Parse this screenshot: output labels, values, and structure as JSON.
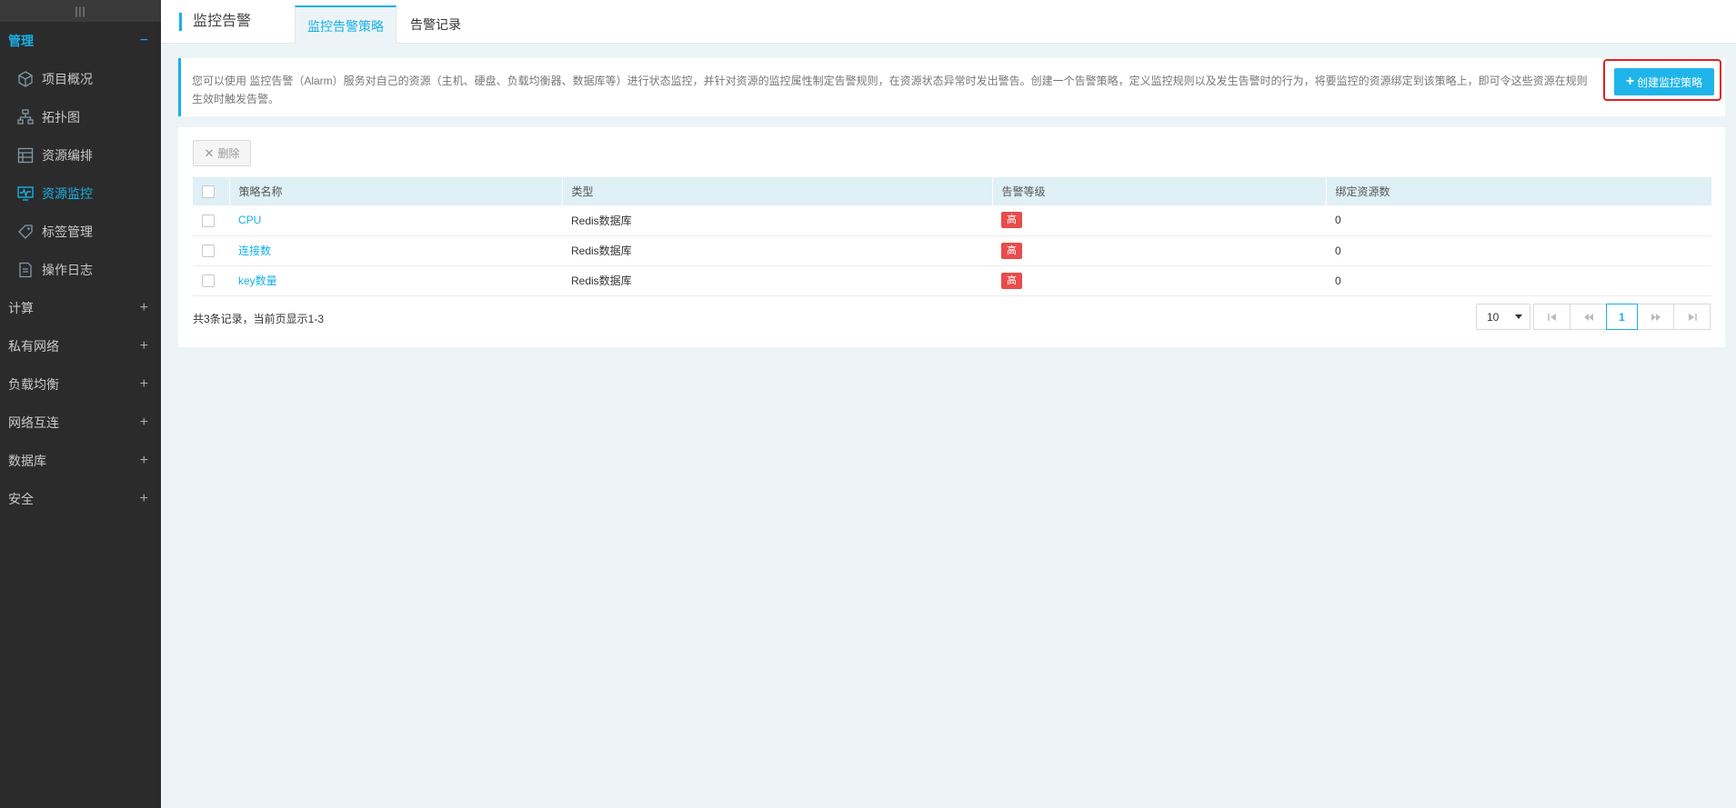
{
  "sidebar": {
    "collapse_glyph": "|||",
    "groups": [
      {
        "label": "管理",
        "sign": "−",
        "active": true
      },
      {
        "label": "计算",
        "sign": "+"
      },
      {
        "label": "私有网络",
        "sign": "+"
      },
      {
        "label": "负载均衡",
        "sign": "+"
      },
      {
        "label": "网络互连",
        "sign": "+"
      },
      {
        "label": "数据库",
        "sign": "+"
      },
      {
        "label": "安全",
        "sign": "+"
      }
    ],
    "items": [
      {
        "label": "项目概况",
        "icon": "cube-icon"
      },
      {
        "label": "拓扑图",
        "icon": "topology-icon"
      },
      {
        "label": "资源编排",
        "icon": "orchestration-icon"
      },
      {
        "label": "资源监控",
        "icon": "monitor-icon",
        "active": true
      },
      {
        "label": "标签管理",
        "icon": "tag-icon"
      },
      {
        "label": "操作日志",
        "icon": "log-icon"
      }
    ]
  },
  "header": {
    "title": "监控告警",
    "tabs": [
      {
        "label": "监控告警策略",
        "active": true
      },
      {
        "label": "告警记录"
      }
    ]
  },
  "info": {
    "text": "您可以使用 监控告警（Alarm）服务对自己的资源（主机、硬盘、负载均衡器、数据库等）进行状态监控，并针对资源的监控属性制定告警规则，在资源状态异常时发出警告。创建一个告警策略，定义监控规则以及发生告警时的行为，将要监控的资源绑定到该策略上，即可令这些资源在规则生效时触发告警。",
    "create_label": "创建监控策略"
  },
  "toolbar": {
    "delete_label": "删除"
  },
  "table": {
    "headers": [
      "策略名称",
      "类型",
      "告警等级",
      "绑定资源数"
    ],
    "rows": [
      {
        "name": "CPU",
        "type": "Redis数据库",
        "level": "高",
        "count": "0"
      },
      {
        "name": "连接数",
        "type": "Redis数据库",
        "level": "高",
        "count": "0"
      },
      {
        "name": "key数量",
        "type": "Redis数据库",
        "level": "高",
        "count": "0"
      }
    ]
  },
  "pagination": {
    "summary": "共3条记录，当前页显示1-3",
    "page_size": "10",
    "current_page": "1"
  },
  "colors": {
    "accent": "#18b1e6",
    "danger": "#e84c4c",
    "sidebar_bg": "#2b2b2b"
  }
}
